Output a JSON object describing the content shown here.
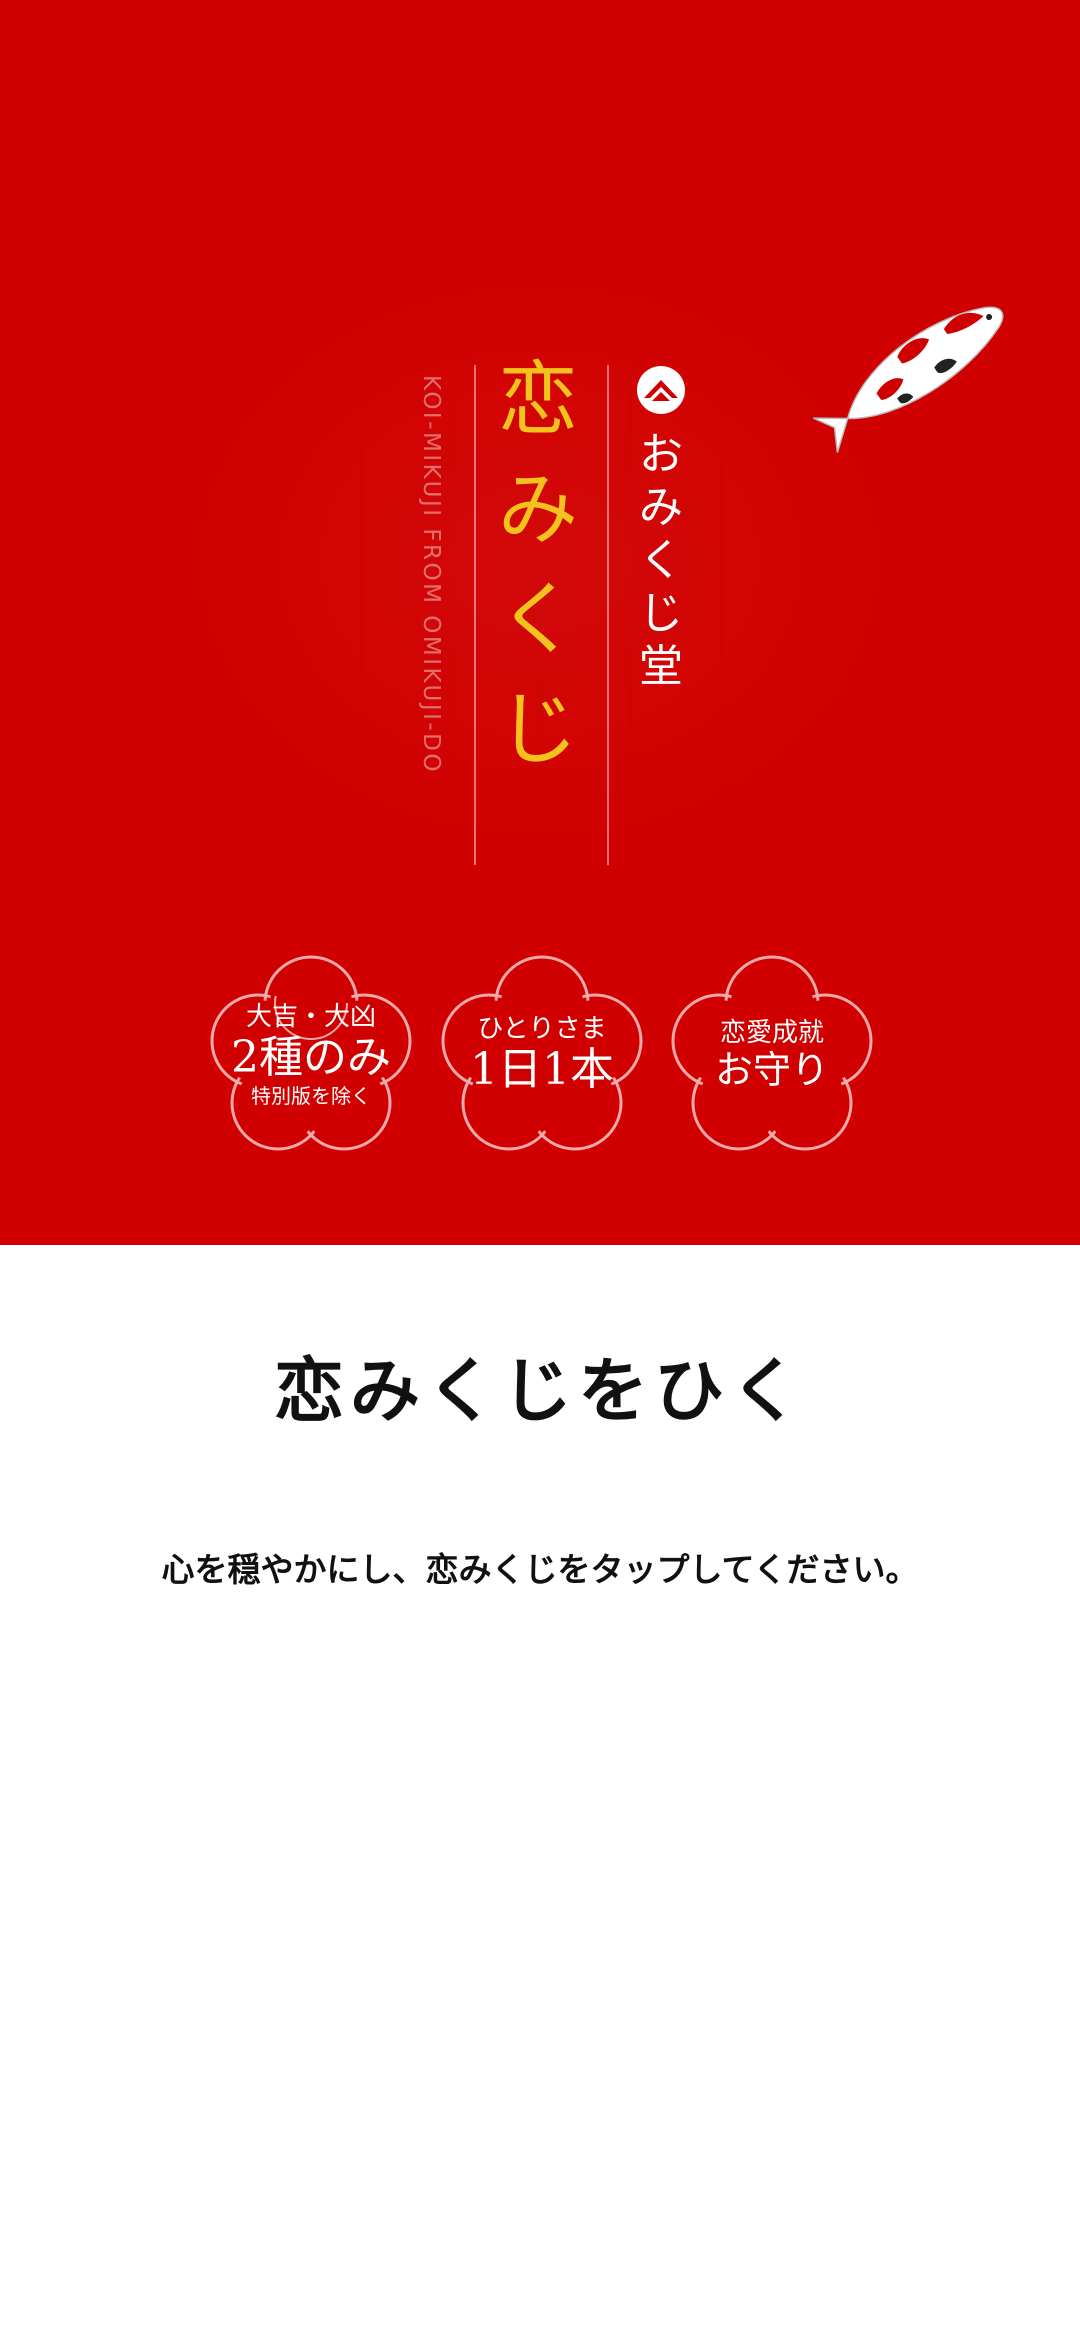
{
  "hero": {
    "subtitle_en": "KOI-MIKUJI FROM OMIKUJI-DO",
    "title_chars": [
      "恋",
      "み",
      "く",
      "じ"
    ],
    "brand_chars": [
      "お",
      "み",
      "く",
      "じ",
      "堂"
    ],
    "colors": {
      "background": "#d10000",
      "title": "#f4c21d",
      "text": "#ffffff"
    }
  },
  "badges": [
    {
      "line1": "大吉・大凶",
      "line2": "2種のみ",
      "line3": "特別版を除く"
    },
    {
      "line1": "ひとりさま",
      "line2": "1日1本"
    },
    {
      "line1": "恋愛成就",
      "line2": "お守り"
    }
  ],
  "main": {
    "heading": "恋みくじをひく",
    "instruction": "心を穏やかにし、恋みくじをタップしてください。"
  }
}
